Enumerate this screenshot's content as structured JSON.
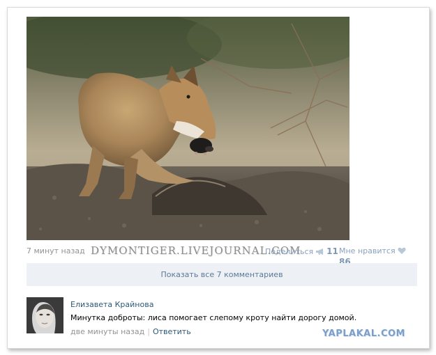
{
  "post": {
    "photo_alt": "",
    "time": "7 минут назад",
    "watermark": "DYMONTIGER.LIVEJOURNAL.COM",
    "share_label": "Поделиться",
    "share_icon": "megaphone-icon",
    "share_count": "11",
    "like_label": "Мне нравится",
    "like_icon": "heart-icon",
    "like_count": "86",
    "show_comments": "Показать все 7 комментариев"
  },
  "comment": {
    "author": "Елизавета Крайнова",
    "text": "Минутка доброты: лиса помогает слепому кроту найти дорогу домой.",
    "time": "две минуты назад",
    "separator": "|",
    "reply": "Ответить"
  },
  "site_watermark": "YAPLAKAL.COM",
  "colors": {
    "link": "#2b587a",
    "muted": "#939393",
    "button_bg": "#edf1f5",
    "counter": "#7d98b6"
  }
}
